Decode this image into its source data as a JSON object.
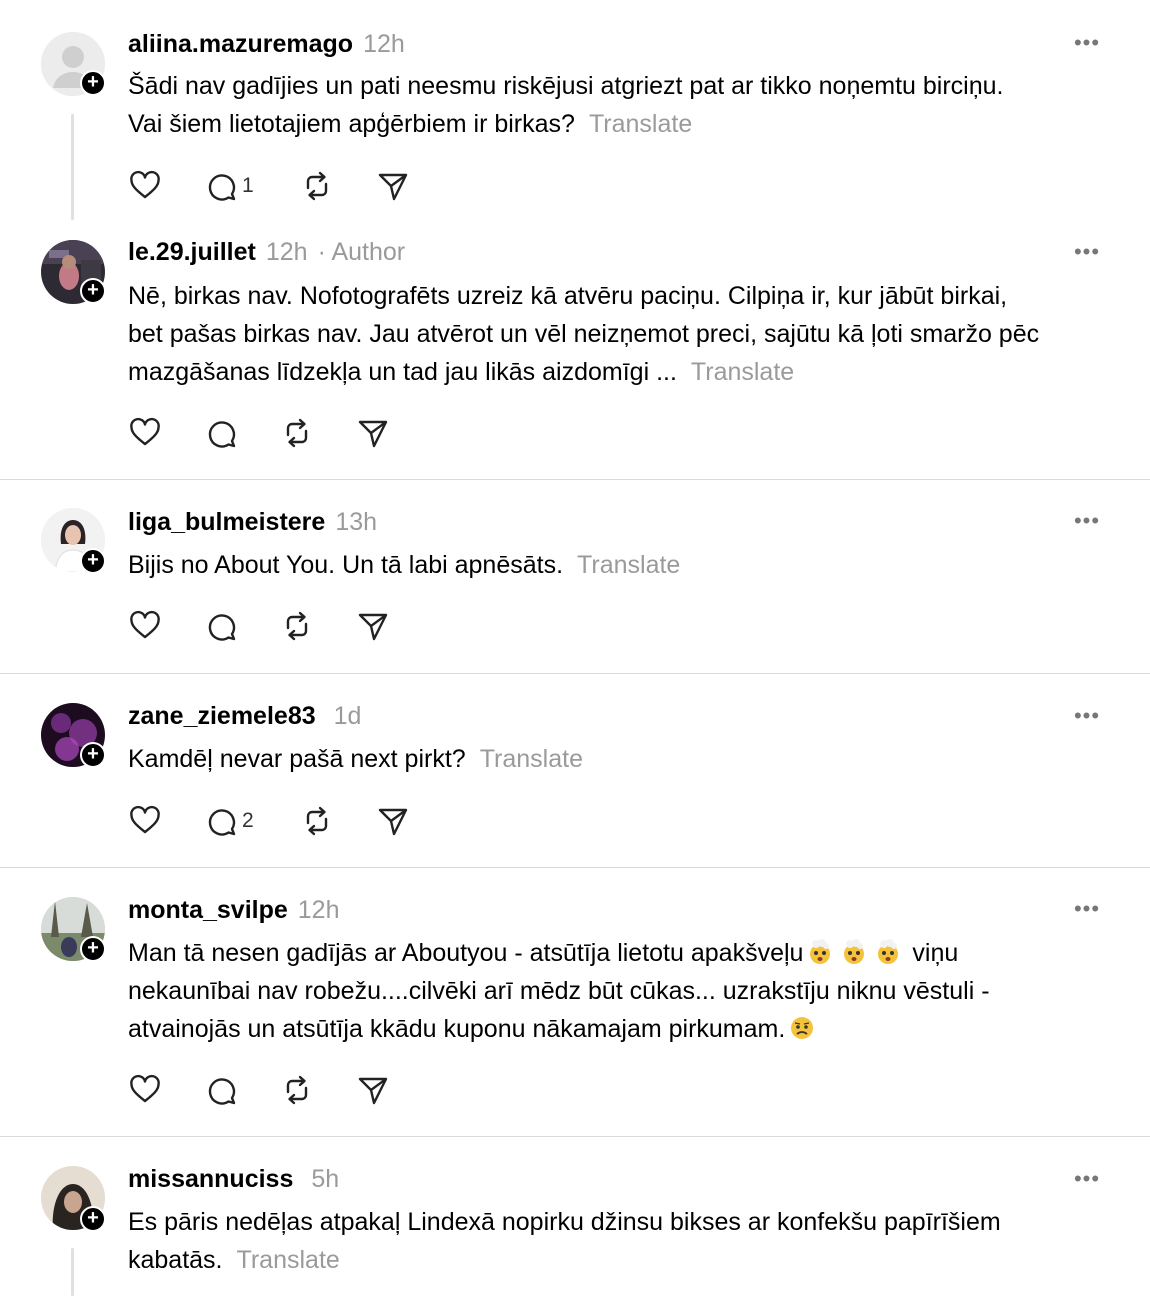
{
  "comments": [
    {
      "username": "aliina.mazuremago",
      "time": "12h",
      "author_label": "",
      "lines": [
        "Šādi nav gadījies un pati neesmu riskējusi atgriezt pat ar tikko noņemtu birciņu.",
        "Vai šiem lietotajiem apģērbiem ir birkas?"
      ],
      "translate": "Translate",
      "reply_count": "1"
    },
    {
      "username": "le.29.juillet",
      "time": "12h",
      "author_label": "· Author",
      "lines": [
        "Nē, birkas nav. Nofotografēts uzreiz kā atvēru paciņu. Cilpiņa ir, kur jābūt birkai,",
        "bet pašas birkas nav. Jau atvērot un vēl neizņemot preci, sajūtu kā ļoti smaržo pēc",
        "mazgāšanas līdzekļa un tad jau likās aizdomīgi ..."
      ],
      "translate": "Translate",
      "reply_count": ""
    },
    {
      "username": "liga_bulmeistere",
      "time": "13h",
      "author_label": "",
      "lines": [
        "Bijis no About You. Un tā labi apnēsāts."
      ],
      "translate": "Translate",
      "reply_count": ""
    },
    {
      "username": "zane_ziemele83",
      "time": "1d",
      "author_label": "",
      "lines": [
        "Kamdēļ nevar pašā next pirkt?"
      ],
      "translate": "Translate",
      "reply_count": "2"
    },
    {
      "username": "monta_svilpe",
      "time": "12h",
      "author_label": "",
      "lines": [
        "Man tā nesen gadījās ar Aboutyou - atsūtīja lietotu apakšveļu",
        "nekaunībai nav robežu....cilvēki arī mēdz būt cūkas... uzrakstīju niknu vēstuli -",
        "atvainojās un atsūtīja kkādu kuponu nākamajam pirkumam."
      ],
      "line1_tail": "viņu",
      "translate": "",
      "reply_count": ""
    },
    {
      "username": "missannuciss",
      "time": "5h",
      "author_label": "",
      "lines": [
        "Es pāris nedēļas atpakaļ Lindexā nopirku džinsu bikses ar konfekšu papīrīšiem",
        "kabatās."
      ],
      "translate": "Translate",
      "reply_count": ""
    }
  ],
  "icons": {
    "more": "more-horizontal-icon",
    "like": "heart-icon",
    "reply": "comment-bubble-icon",
    "repost": "repost-icon",
    "share": "send-icon",
    "follow": "plus-icon"
  },
  "colors": {
    "muted": "#9a9a9a",
    "divider": "#dbdbdb"
  }
}
